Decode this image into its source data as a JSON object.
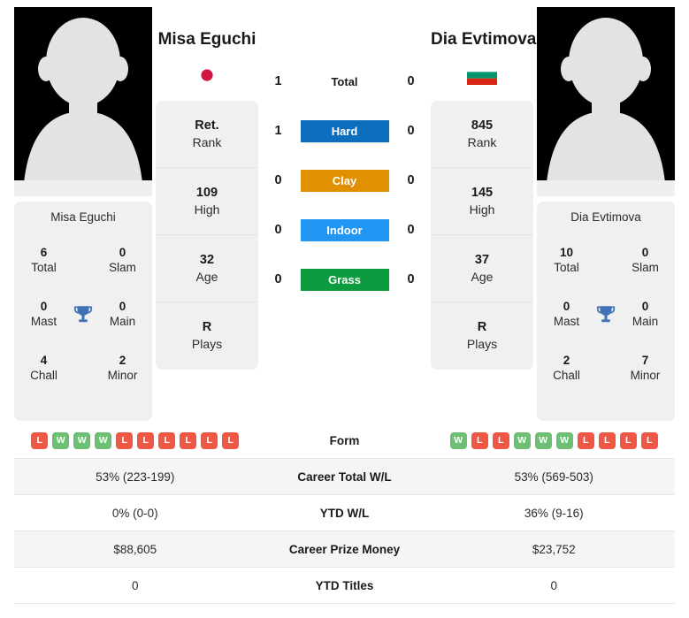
{
  "players": {
    "left": {
      "name": "Misa Eguchi",
      "flag": "japan-flag",
      "card_name": "Misa Eguchi",
      "titles": [
        {
          "value": "6",
          "label": "Total"
        },
        {
          "value": "0",
          "label": "Slam"
        },
        {
          "value": "0",
          "label": "Mast"
        },
        {
          "value": "0",
          "label": "Main"
        },
        {
          "value": "4",
          "label": "Chall"
        },
        {
          "value": "2",
          "label": "Minor"
        }
      ],
      "stats": [
        {
          "value": "Ret.",
          "label": "Rank"
        },
        {
          "value": "109",
          "label": "High"
        },
        {
          "value": "32",
          "label": "Age"
        },
        {
          "value": "R",
          "label": "Plays"
        }
      ],
      "form": [
        "L",
        "W",
        "W",
        "W",
        "L",
        "L",
        "L",
        "L",
        "L",
        "L"
      ]
    },
    "right": {
      "name": "Dia Evtimova",
      "flag": "bulgaria-flag",
      "card_name": "Dia Evtimova",
      "titles": [
        {
          "value": "10",
          "label": "Total"
        },
        {
          "value": "0",
          "label": "Slam"
        },
        {
          "value": "0",
          "label": "Mast"
        },
        {
          "value": "0",
          "label": "Main"
        },
        {
          "value": "2",
          "label": "Chall"
        },
        {
          "value": "7",
          "label": "Minor"
        }
      ],
      "stats": [
        {
          "value": "845",
          "label": "Rank"
        },
        {
          "value": "145",
          "label": "High"
        },
        {
          "value": "37",
          "label": "Age"
        },
        {
          "value": "R",
          "label": "Plays"
        }
      ],
      "form": [
        "W",
        "L",
        "L",
        "W",
        "W",
        "W",
        "L",
        "L",
        "L",
        "L"
      ]
    }
  },
  "h2h": [
    {
      "left": "1",
      "label": "Total",
      "right": "0",
      "type": "plain",
      "color": ""
    },
    {
      "left": "1",
      "label": "Hard",
      "right": "0",
      "type": "badge",
      "color": "#0d6ebd"
    },
    {
      "left": "0",
      "label": "Clay",
      "right": "0",
      "type": "badge",
      "color": "#e09000"
    },
    {
      "left": "0",
      "label": "Indoor",
      "right": "0",
      "type": "badge",
      "color": "#2196f3"
    },
    {
      "left": "0",
      "label": "Grass",
      "right": "0",
      "type": "badge",
      "color": "#0d9b3f"
    }
  ],
  "table": {
    "form_label": "Form",
    "rows": [
      {
        "left": "53% (223-199)",
        "label": "Career Total W/L",
        "right": "53% (569-503)"
      },
      {
        "left": "0% (0-0)",
        "label": "YTD W/L",
        "right": "36% (9-16)"
      },
      {
        "left": "$88,605",
        "label": "Career Prize Money",
        "right": "$23,752"
      },
      {
        "left": "0",
        "label": "YTD Titles",
        "right": "0"
      }
    ]
  },
  "colors": {
    "win": "#6cbf73",
    "loss": "#ef5844",
    "trophy": "#3f72b5",
    "card_bg": "#f0f0f0"
  }
}
